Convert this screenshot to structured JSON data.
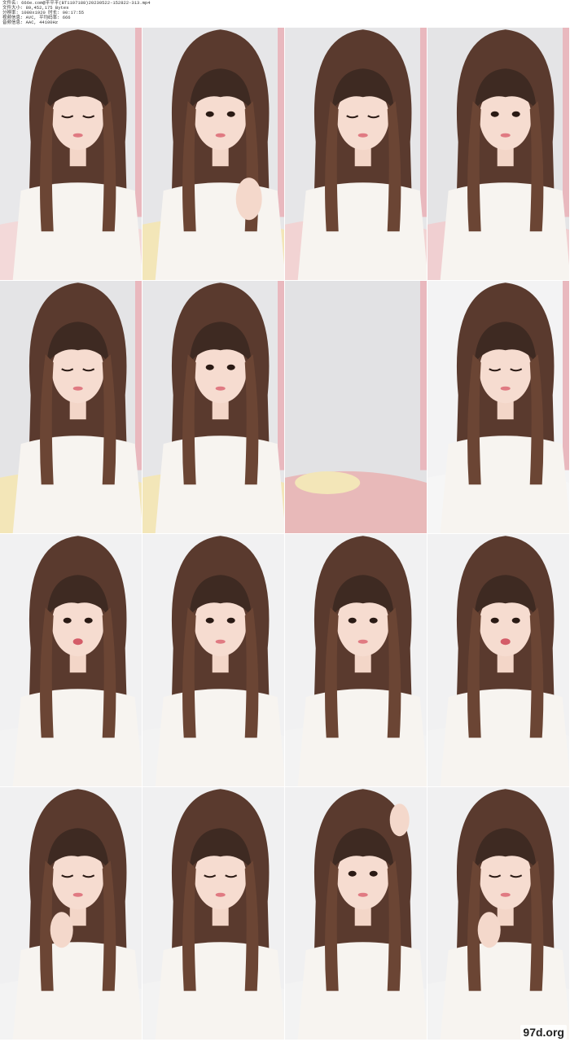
{
  "header": {
    "lines": [
      "文件名: 666e.com@平平平(BT1107188)20230522-152822-313.mp4",
      "文件大小: 89,452,175 Bytes",
      "分辨率: 1080x1920 时长: 00:17:55",
      "视频信息: AVC, 平均码率: 666",
      "音频信息: AAC, 44100Hz",
      "时长: 00:17:55"
    ]
  },
  "watermark": "97d.org",
  "thumbnails": [
    {
      "id": 1,
      "pose": "look-down",
      "bg": "#e8e8ea",
      "bed": "#f3d9d9",
      "hand": "none"
    },
    {
      "id": 2,
      "pose": "front",
      "bg": "#e6e6e8",
      "bed": "#f3e6b8",
      "hand": "raised"
    },
    {
      "id": 3,
      "pose": "look-down",
      "bg": "#e6e6e8",
      "bed": "#f2d3d3",
      "hand": "none"
    },
    {
      "id": 4,
      "pose": "smirk",
      "bg": "#e4e4e6",
      "bed": "#f0cfd1",
      "hand": "none"
    },
    {
      "id": 5,
      "pose": "look-down",
      "bg": "#e4e4e6",
      "bed": "#f3e6b8",
      "hand": "none"
    },
    {
      "id": 6,
      "pose": "front",
      "bg": "#e6e6e8",
      "bed": "#f3e6b8",
      "hand": "none"
    },
    {
      "id": 7,
      "pose": "empty",
      "bg": "#e2e2e4",
      "bed": "#e8b9b9",
      "hand": "none"
    },
    {
      "id": 8,
      "pose": "look-down",
      "bg": "#f3f3f4",
      "bed": "#f6f6f6",
      "hand": "none"
    },
    {
      "id": 9,
      "pose": "speaking",
      "bg": "#f1f1f2",
      "bed": "#f3f3f3",
      "hand": "none"
    },
    {
      "id": 10,
      "pose": "front",
      "bg": "#f1f1f2",
      "bed": "#f3f3f3",
      "hand": "none"
    },
    {
      "id": 11,
      "pose": "front",
      "bg": "#f1f1f2",
      "bed": "#f3f3f3",
      "hand": "none"
    },
    {
      "id": 12,
      "pose": "speaking",
      "bg": "#f1f1f2",
      "bed": "#f3f3f3",
      "hand": "none"
    },
    {
      "id": 13,
      "pose": "look-down",
      "bg": "#f0f0f1",
      "bed": "#f3f3f3",
      "hand": "chin"
    },
    {
      "id": 14,
      "pose": "look-down",
      "bg": "#f0f0f1",
      "bed": "#f3f3f3",
      "hand": "none"
    },
    {
      "id": 15,
      "pose": "front",
      "bg": "#f0f0f1",
      "bed": "#f3f3f3",
      "hand": "head"
    },
    {
      "id": 16,
      "pose": "look-down",
      "bg": "#f0f0f1",
      "bed": "#f3f3f3",
      "hand": "chin"
    }
  ]
}
